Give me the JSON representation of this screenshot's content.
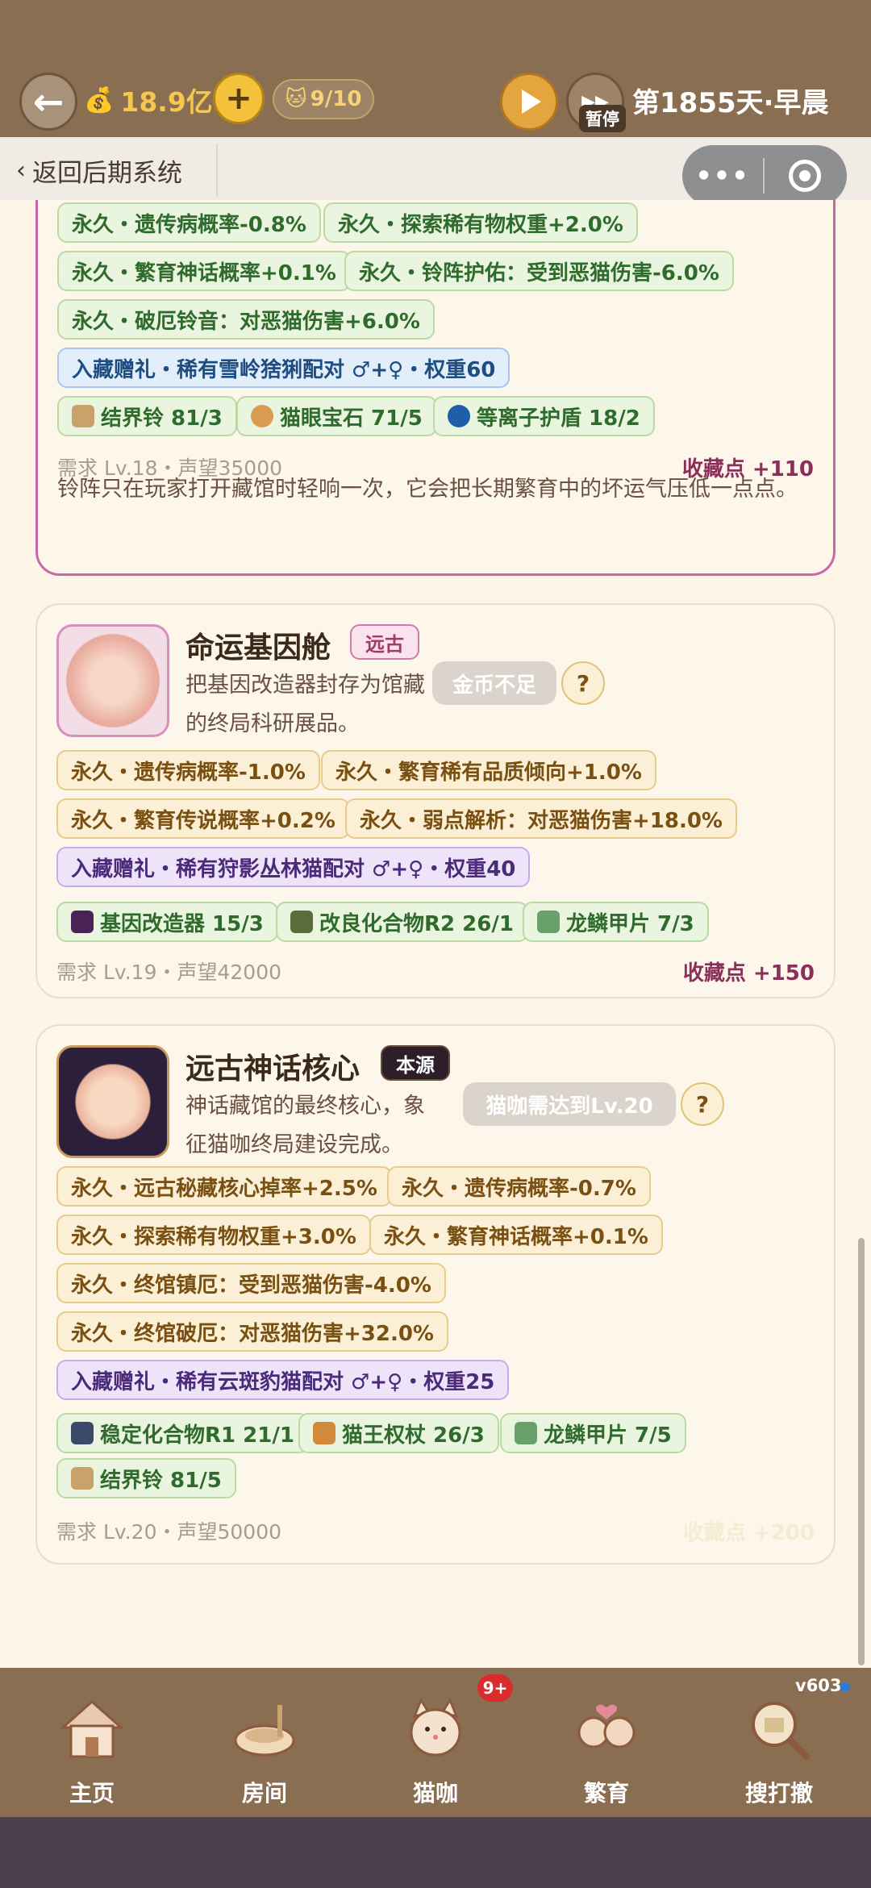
{
  "header": {
    "money": "18.9亿",
    "plus_label": "+",
    "cat_count": "9/10",
    "pause_label": "暂停",
    "day_label": "第1855天·早晨"
  },
  "nav": {
    "back_label": "返回后期系统"
  },
  "cards": [
    {
      "effects": [
        "永久・遗传病概率-0.8%",
        "永久・探索稀有物权重+2.0%",
        "永久・繁育神话概率+0.1%",
        "永久・铃阵护佑：受到恶猫伤害-6.0%",
        "永久・破厄铃音：对恶猫伤害+6.0%"
      ],
      "gift": "入藏赠礼・稀有雪岭猞猁配对 ♂+♀・权重60",
      "materials": [
        "结界铃 81/3",
        "猫眼宝石 71/5",
        "等离子护盾 18/2"
      ],
      "requirement": "需求 Lv.18・声望35000",
      "points": "收藏点 +110",
      "description": "铃阵只在玩家打开藏馆时轻响一次，它会把长期繁育中的坏运气压低一点点。"
    },
    {
      "title": "命运基因舱",
      "badge": "远古",
      "subtitle": "把基因改造器封存为馆藏的终局科研展品。",
      "button": "金币不足",
      "help": "?",
      "effects": [
        "永久・遗传病概率-1.0%",
        "永久・繁育稀有品质倾向+1.0%",
        "永久・繁育传说概率+0.2%",
        "永久・弱点解析：对恶猫伤害+18.0%"
      ],
      "gift": "入藏赠礼・稀有狩影丛林猫配对 ♂+♀・权重40",
      "materials": [
        "基因改造器 15/3",
        "改良化合物R2 26/1",
        "龙鳞甲片 7/3"
      ],
      "requirement": "需求 Lv.19・声望42000",
      "points": "收藏点 +150"
    },
    {
      "title": "远古神话核心",
      "badge": "本源",
      "subtitle": "神话藏馆的最终核心，象征猫咖终局建设完成。",
      "button": "猫咖需达到Lv.20",
      "help": "?",
      "effects": [
        "永久・远古秘藏核心掉率+2.5%",
        "永久・遗传病概率-0.7%",
        "永久・探索稀有物权重+3.0%",
        "永久・繁育神话概率+0.1%",
        "永久・终馆镇厄：受到恶猫伤害-4.0%",
        "永久・终馆破厄：对恶猫伤害+32.0%"
      ],
      "gift": "入藏赠礼・稀有云斑豹猫配对 ♂+♀・权重25",
      "materials": [
        "稳定化合物R1 21/1",
        "猫王权杖 26/3",
        "龙鳞甲片 7/5",
        "结界铃 81/5"
      ],
      "requirement": "需求 Lv.20・声望50000",
      "points": "收藏点 +200"
    }
  ],
  "bottom_nav": {
    "version": "v603",
    "badge": "9+",
    "tabs": [
      "主页",
      "房间",
      "猫咖",
      "繁育",
      "搜打撤"
    ]
  },
  "colors": {
    "header_bg": "#8a6e52",
    "page_bg": "#fcf5e8",
    "accent_pink": "#c868a8",
    "points_color": "#8a2e5a"
  }
}
